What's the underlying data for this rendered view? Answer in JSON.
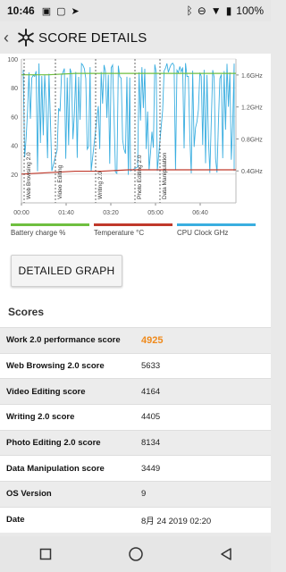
{
  "status_bar": {
    "time": "10:46",
    "battery": "100%"
  },
  "app_bar": {
    "title": "SCORE DETAILS"
  },
  "chart_data": {
    "type": "line",
    "x_tick_labels": [
      "00:00",
      "01:40",
      "03:20",
      "05:00",
      "06:40"
    ],
    "y_left_ticks": [
      20,
      40,
      60,
      80,
      100
    ],
    "y_right_ticks": [
      "0.4GHz",
      "0.8GHz",
      "1.2GHz",
      "1.6GHz"
    ],
    "ylim": [
      0,
      100
    ],
    "section_labels": [
      "Web Browsing 2.0",
      "Video Editing",
      "Writing 2.0",
      "Photo Editing 2.0",
      "Data Manipulation"
    ],
    "series": [
      {
        "name": "Battery charge %",
        "values": [
          89,
          89,
          90,
          90,
          90,
          90,
          90,
          90,
          90
        ]
      },
      {
        "name": "Temperature °C",
        "values": [
          20,
          21,
          22,
          22,
          23,
          23,
          23,
          23,
          23
        ]
      },
      {
        "name": "CPU Clock GHz",
        "values": [
          0.4,
          1.6,
          0.4,
          1.6,
          0.4,
          1.6,
          0.4,
          1.6,
          0.4
        ]
      }
    ],
    "legend": [
      "Battery charge %",
      "Temperature °C",
      "CPU Clock GHz"
    ],
    "colors": {
      "battery": "#6fbf3f",
      "temperature": "#c0392b",
      "cpu": "#3aaee0"
    }
  },
  "legend": {
    "battery": "Battery charge %",
    "temperature": "Temperature °C",
    "cpu": "CPU Clock GHz"
  },
  "buttons": {
    "detailed_graph": "DETAILED GRAPH"
  },
  "scores_heading": "Scores",
  "scores": [
    {
      "label": "Work 2.0 performance score",
      "value": "4925"
    },
    {
      "label": "Web Browsing 2.0 score",
      "value": "5633"
    },
    {
      "label": "Video Editing score",
      "value": "4164"
    },
    {
      "label": "Writing 2.0 score",
      "value": "4405"
    },
    {
      "label": "Photo Editing 2.0 score",
      "value": "8134"
    },
    {
      "label": "Data Manipulation score",
      "value": "3449"
    },
    {
      "label": "OS Version",
      "value": "9"
    },
    {
      "label": "Date",
      "value": "8月 24 2019 02:20"
    }
  ]
}
